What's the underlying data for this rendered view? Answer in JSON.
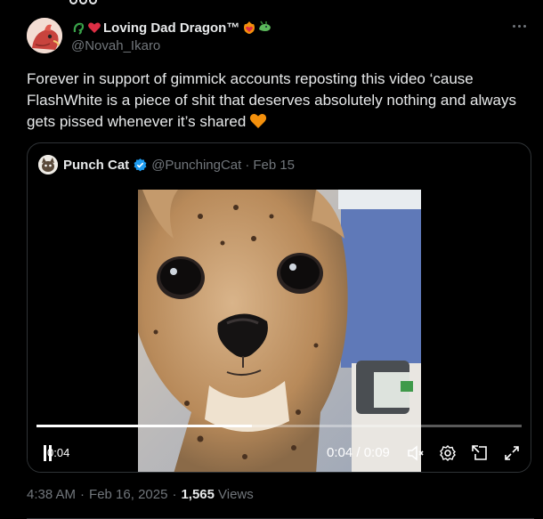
{
  "author": {
    "display_name": "Loving Dad Dragon™",
    "handle": "@Novah_Ikaro"
  },
  "tweet": {
    "text": "Forever in support of gimmick accounts reposting this video ‘cause FlashWhite is a piece of shit that deserves absolutely nothing and always gets pissed whenever it’s shared"
  },
  "quote": {
    "display_name": "Punch Cat",
    "handle": "@PunchingCat",
    "date": "Feb 15"
  },
  "video": {
    "current_time": "0:04",
    "time_display": "0:04 / 0:09",
    "progress": 0.444
  },
  "meta": {
    "time": "4:38 AM",
    "date": "Feb 16, 2025",
    "views_count": "1,565",
    "views_label": "Views"
  },
  "icons": {
    "more": "more-dots-icon",
    "verified": "verified-badge-icon",
    "pause": "pause-icon",
    "mute": "volume-muted-icon",
    "settings": "gear-icon",
    "picture_in_picture": "pip-icon",
    "fullscreen": "fullscreen-icon"
  },
  "colors": {
    "background": "#000000",
    "text_primary": "#e7e9ea",
    "text_secondary": "#71767b",
    "border": "#2f3336",
    "verified_blue": "#1d9bf0",
    "heart_orange": "#f4900c",
    "heart_red": "#dd2e44"
  }
}
